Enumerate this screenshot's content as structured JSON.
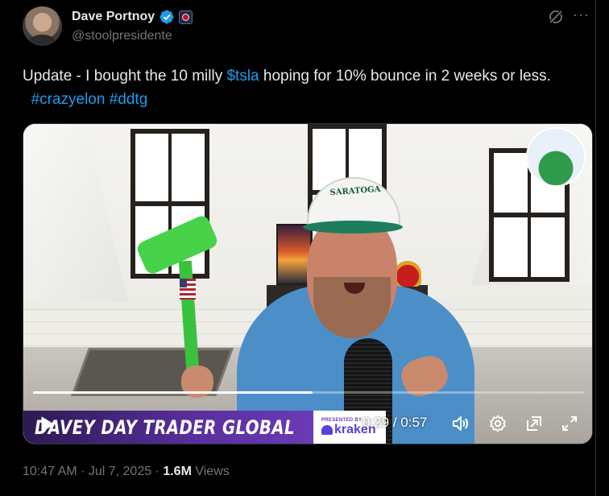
{
  "author": {
    "display_name": "Dave Portnoy",
    "handle": "@stoolpresidente",
    "verified_icon": "verified-badge-icon",
    "affiliate_icon": "affiliate-badge-icon"
  },
  "header_actions": {
    "grok_icon": "grok-icon",
    "more_label": "···"
  },
  "tweet": {
    "text_before_cashtag": "Update - I bought the 10 milly ",
    "cashtag": "$tsla",
    "text_after_cashtag": " hoping for 10% bounce in 2 weeks or less.",
    "spacer": "  ",
    "hashtag_1": "#crazyelon",
    "hashtag_2": "#ddtg"
  },
  "video": {
    "banner_title": "DAVEY DAY TRADER GLOBAL",
    "sponsor_presented_by": "PRESENTED BY",
    "sponsor_name": "kraken",
    "hat_text": "SARATOGA",
    "current_time": "0:29",
    "duration": "0:57",
    "time_separator": " / ",
    "progress": 0.508,
    "controls": [
      "play-icon",
      "volume-icon",
      "settings-icon",
      "picture-in-picture-icon",
      "fullscreen-icon"
    ]
  },
  "footer": {
    "time": "10:47 AM",
    "separator": " · ",
    "date": "Jul 7, 2025",
    "views_count": "1.6M",
    "views_label": " Views"
  },
  "colors": {
    "background": "#000000",
    "text_primary": "#e7e9ea",
    "text_secondary": "#71767b",
    "link": "#1d9bf0",
    "verified": "#1d9bf0"
  }
}
